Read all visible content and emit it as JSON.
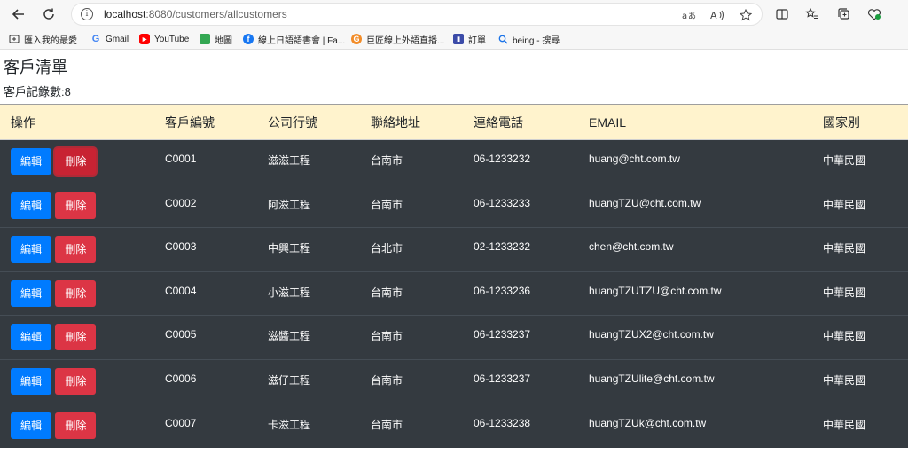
{
  "browser": {
    "url_host": "localhost",
    "url_rest": ":8080/customers/allcustomers",
    "bookmarks": [
      {
        "label": "匯入我的最愛",
        "icon": "import-favorites-icon"
      },
      {
        "label": "Gmail",
        "icon": "google-icon",
        "color": "#4285f4"
      },
      {
        "label": "YouTube",
        "icon": "youtube-icon",
        "color": "#ff0000"
      },
      {
        "label": "地圖",
        "icon": "maps-icon",
        "color": "#34a853"
      },
      {
        "label": "線上日語語書會 | Fa...",
        "icon": "facebook-icon",
        "color": "#1877f2"
      },
      {
        "label": "巨匠線上外語直播...",
        "icon": "site-icon",
        "color": "#f28c28"
      },
      {
        "label": "訂單",
        "icon": "order-icon",
        "color": "#3b4ba8"
      },
      {
        "label": "being - 搜尋",
        "icon": "search-icon",
        "color": "#1a73e8"
      }
    ]
  },
  "page": {
    "title": "客戶清單",
    "record_count": "客戶記錄數:8"
  },
  "table": {
    "headers": [
      "操作",
      "客戶編號",
      "公司行號",
      "聯絡地址",
      "連絡電話",
      "EMAIL",
      "國家別"
    ],
    "edit_label": "編輯",
    "delete_label": "刪除",
    "rows": [
      {
        "id": "C0001",
        "company": "滋滋工程",
        "address": "台南市",
        "phone": "06-1233232",
        "email": "huang@cht.com.tw",
        "country": "中華民國"
      },
      {
        "id": "C0002",
        "company": "阿滋工程",
        "address": "台南市",
        "phone": "06-1233233",
        "email": "huangTZU@cht.com.tw",
        "country": "中華民國"
      },
      {
        "id": "C0003",
        "company": "中興工程",
        "address": "台北市",
        "phone": "02-1233232",
        "email": "chen@cht.com.tw",
        "country": "中華民國"
      },
      {
        "id": "C0004",
        "company": "小滋工程",
        "address": "台南市",
        "phone": "06-1233236",
        "email": "huangTZUTZU@cht.com.tw",
        "country": "中華民國"
      },
      {
        "id": "C0005",
        "company": "滋醬工程",
        "address": "台南市",
        "phone": "06-1233237",
        "email": "huangTZUX2@cht.com.tw",
        "country": "中華民國"
      },
      {
        "id": "C0006",
        "company": "滋仔工程",
        "address": "台南市",
        "phone": "06-1233237",
        "email": "huangTZUlite@cht.com.tw",
        "country": "中華民國"
      },
      {
        "id": "C0007",
        "company": "卡滋工程",
        "address": "台南市",
        "phone": "06-1233238",
        "email": "huangTZUk@cht.com.tw",
        "country": "中華民國"
      }
    ]
  },
  "colors": {
    "header_bg": "#fff3cd",
    "row_bg": "#343a40",
    "edit_button": "#007bff",
    "delete_button": "#dc3545"
  }
}
